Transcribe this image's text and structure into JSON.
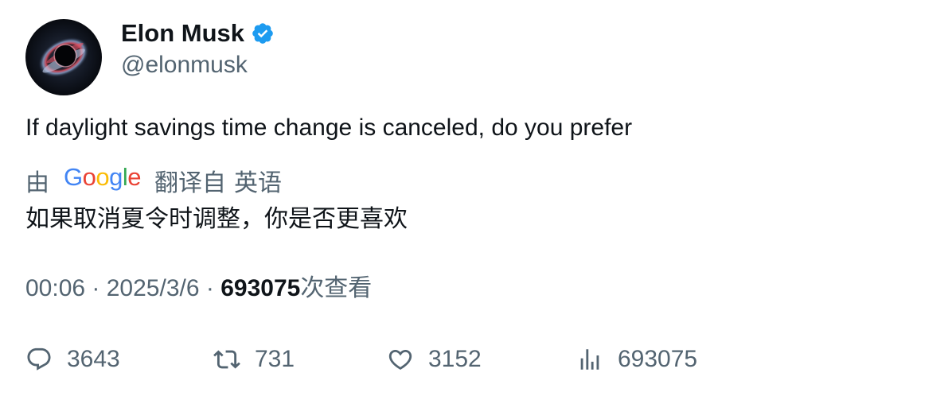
{
  "author": {
    "display_name": "Elon Musk",
    "handle": "@elonmusk",
    "verified": true,
    "verified_color": "#1d9bf0"
  },
  "tweet": {
    "text": "If daylight savings time change is canceled, do you prefer"
  },
  "translation": {
    "prefix": "由",
    "provider_logo": "Google",
    "suffix": "翻译自",
    "source_language": "英语",
    "translated_text": "如果取消夏令时调整，你是否更喜欢"
  },
  "meta": {
    "time": "00:06",
    "separator": " · ",
    "date": "2025/3/6",
    "views_count": "693075",
    "views_label": "次查看"
  },
  "actions": {
    "reply": {
      "icon": "reply-icon",
      "count": "3643"
    },
    "retweet": {
      "icon": "retweet-icon",
      "count": "731"
    },
    "like": {
      "icon": "heart-icon",
      "count": "3152"
    },
    "views": {
      "icon": "analytics-icon",
      "count": "693075"
    }
  },
  "colors": {
    "text_primary": "#0f1419",
    "text_secondary": "#536471",
    "google_blue": "#4285F4",
    "google_red": "#EA4335",
    "google_yellow": "#FBBC05",
    "google_green": "#34A853"
  }
}
